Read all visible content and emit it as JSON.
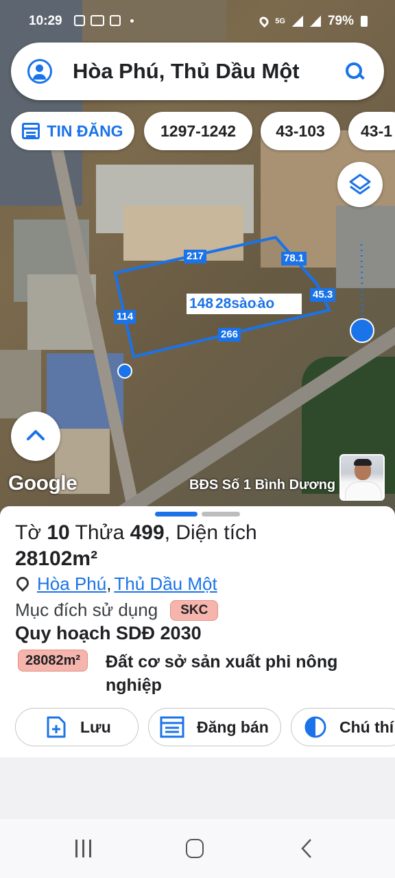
{
  "status_bar": {
    "time": "10:29",
    "network": "5G",
    "battery": "79%"
  },
  "search": {
    "query": "Hòa Phú, Thủ Dầu Một"
  },
  "chips": [
    {
      "label": "TIN ĐĂNG"
    },
    {
      "label": "1297-1242"
    },
    {
      "label": "43-103"
    },
    {
      "label": "43-1"
    }
  ],
  "map": {
    "edge_labels": [
      "217",
      "78.1",
      "45.3",
      "114",
      "266"
    ],
    "parcel_labels": [
      "148",
      "28sào",
      "sào"
    ],
    "google_logo": "Google",
    "watermark": "BĐS Số 1 Bình Dương"
  },
  "parcel": {
    "title_prefix": "Tờ ",
    "sheet_no": "10",
    "title_mid": " Thửa ",
    "lot_no": "499",
    "title_suffix": ", Diện tích",
    "area": "28102m²",
    "ward": "Hòa Phú",
    "separator": ",",
    "district": "Thủ Dầu Một",
    "purpose_label": "Mục đích sử dụng",
    "purpose_code": "SKC",
    "plan_title": "Quy hoạch SDĐ 2030",
    "plan_area": "28082m²",
    "plan_land_type": "Đất cơ sở sản xuất phi nông nghiệp"
  },
  "actions": {
    "save": "Lưu",
    "post": "Đăng bán",
    "legend": "Chú thí"
  },
  "colors": {
    "accent": "#1a73e8",
    "badge_bg": "#f5b5ad"
  }
}
